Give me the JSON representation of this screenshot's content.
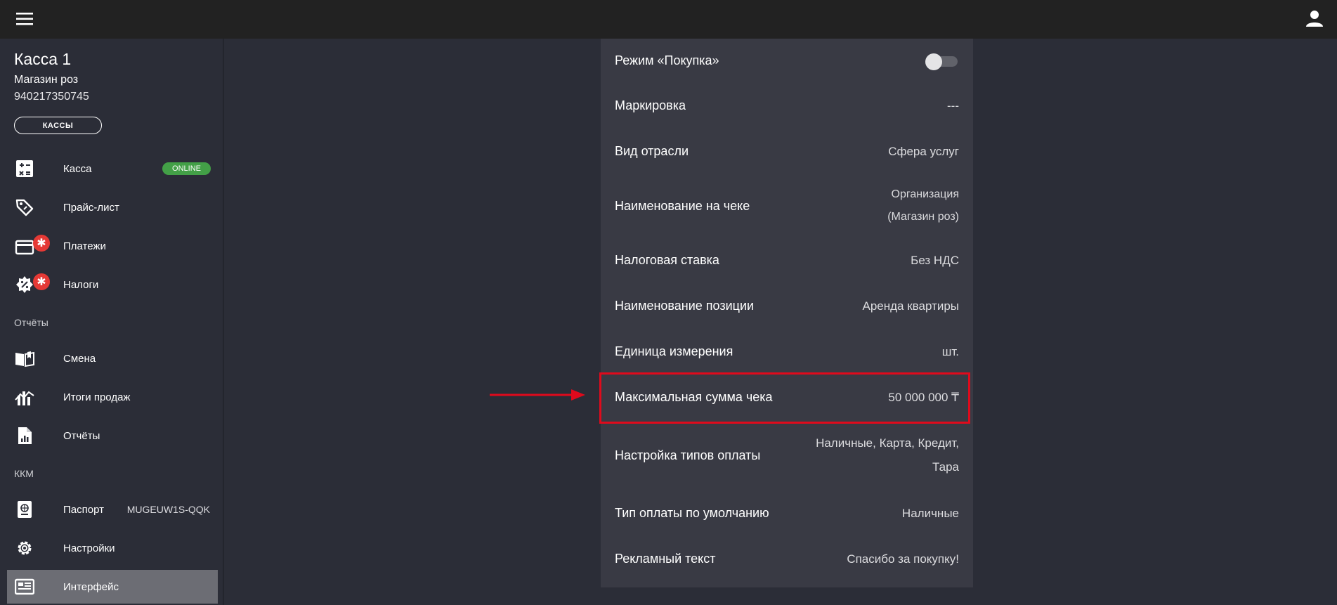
{
  "header": {
    "menu_icon": "hamburger-icon",
    "user_icon": "user-icon"
  },
  "sidebar": {
    "cash_title": "Касса 1",
    "shop_name": "Магазин роз",
    "shop_id": "940217350745",
    "kassy_button": "КАССЫ",
    "items_main": [
      {
        "label": "Касса",
        "icon": "calculator-icon",
        "badge": "ONLINE"
      },
      {
        "label": "Прайс-лист",
        "icon": "price-tag-icon"
      },
      {
        "label": "Платежи",
        "icon": "payment-card-icon",
        "alert": "✱"
      },
      {
        "label": "Налоги",
        "icon": "tax-badge-icon",
        "alert": "✱"
      }
    ],
    "section_reports": "Отчёты",
    "items_reports": [
      {
        "label": "Смена",
        "icon": "book-icon"
      },
      {
        "label": "Итоги продаж",
        "icon": "sales-chart-icon"
      },
      {
        "label": "Отчёты",
        "icon": "report-file-icon"
      }
    ],
    "section_kkm": "ККМ",
    "items_kkm": [
      {
        "label": "Паспорт",
        "icon": "passport-icon",
        "extra": "MUGEUW1S-QQK"
      },
      {
        "label": "Настройки",
        "icon": "gear-icon"
      },
      {
        "label": "Интерфейс",
        "icon": "interface-icon",
        "active": true
      }
    ]
  },
  "settings": {
    "rows": [
      {
        "label": "Режим «Покупка»",
        "value": "",
        "toggle": false
      },
      {
        "label": "Маркировка",
        "value": "---"
      },
      {
        "label": "Вид отрасли",
        "value": "Сфера услуг"
      },
      {
        "label": "Наименование на чеке",
        "value": "Организация",
        "value2": "(Магазин роз)"
      },
      {
        "label": "Налоговая ставка",
        "value": "Без НДС"
      },
      {
        "label": "Наименование позиции",
        "value": "Аренда квартиры"
      },
      {
        "label": "Единица измерения",
        "value": "шт."
      },
      {
        "label": "Максимальная сумма чека",
        "value": "50 000 000 ₸"
      },
      {
        "label": "Настройка типов оплаты",
        "value": "Наличные, Карта, Кредит,",
        "value2": "Тара"
      },
      {
        "label": "Тип оплаты по умолчанию",
        "value": "Наличные"
      },
      {
        "label": "Рекламный текст",
        "value": "Спасибо за покупку!"
      }
    ]
  },
  "annotation": {
    "highlight_color": "#e00a1c"
  }
}
